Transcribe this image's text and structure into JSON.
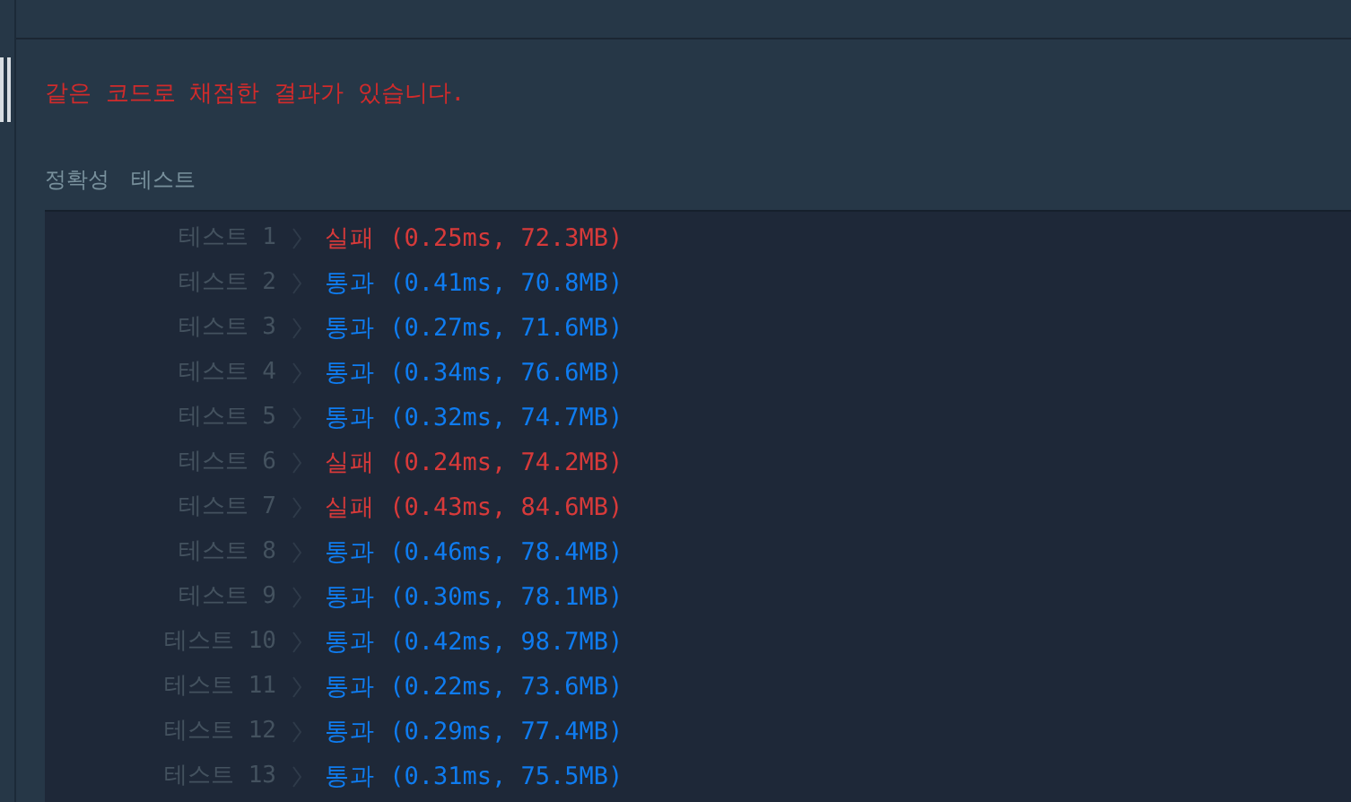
{
  "message": "같은 코드로 채점한 결과가 있습니다.",
  "section": {
    "title": "정확성",
    "subtitle": "테스트"
  },
  "rows": [
    {
      "label": "테스트 1",
      "passed": false,
      "result": "실패 (0.25ms, 72.3MB)"
    },
    {
      "label": "테스트 2",
      "passed": true,
      "result": "통과 (0.41ms, 70.8MB)"
    },
    {
      "label": "테스트 3",
      "passed": true,
      "result": "통과 (0.27ms, 71.6MB)"
    },
    {
      "label": "테스트 4",
      "passed": true,
      "result": "통과 (0.34ms, 76.6MB)"
    },
    {
      "label": "테스트 5",
      "passed": true,
      "result": "통과 (0.32ms, 74.7MB)"
    },
    {
      "label": "테스트 6",
      "passed": false,
      "result": "실패 (0.24ms, 74.2MB)"
    },
    {
      "label": "테스트 7",
      "passed": false,
      "result": "실패 (0.43ms, 84.6MB)"
    },
    {
      "label": "테스트 8",
      "passed": true,
      "result": "통과 (0.46ms, 78.4MB)"
    },
    {
      "label": "테스트 9",
      "passed": true,
      "result": "통과 (0.30ms, 78.1MB)"
    },
    {
      "label": "테스트 10",
      "passed": true,
      "result": "통과 (0.42ms, 98.7MB)"
    },
    {
      "label": "테스트 11",
      "passed": true,
      "result": "통과 (0.22ms, 73.6MB)"
    },
    {
      "label": "테스트 12",
      "passed": true,
      "result": "통과 (0.29ms, 77.4MB)"
    },
    {
      "label": "테스트 13",
      "passed": true,
      "result": "통과 (0.31ms, 75.5MB)"
    }
  ]
}
